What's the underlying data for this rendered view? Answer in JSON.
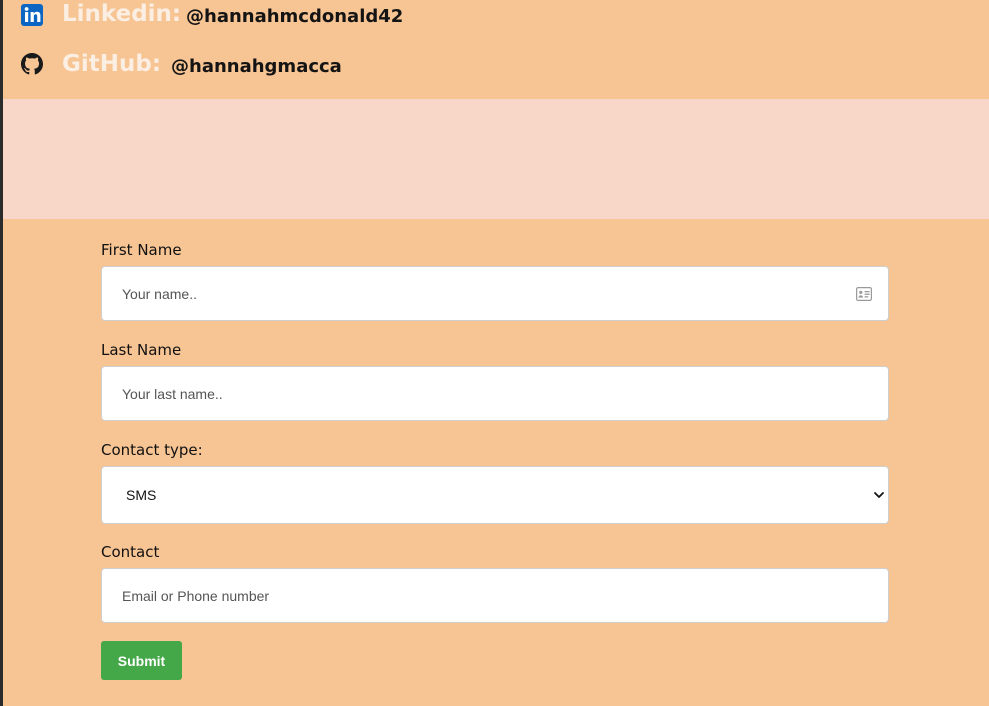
{
  "social": {
    "linkedin": {
      "label": "Linkedin:",
      "handle": "@hannahmcdonald42"
    },
    "github": {
      "label": "GitHub:",
      "handle": "@hannahgmacca"
    }
  },
  "form": {
    "first_name": {
      "label": "First Name",
      "placeholder": "Your name.."
    },
    "last_name": {
      "label": "Last Name",
      "placeholder": "Your last name.."
    },
    "contact_type": {
      "label": "Contact type:",
      "selected": "SMS"
    },
    "contact": {
      "label": "Contact",
      "placeholder": "Email or Phone number"
    },
    "submit_label": "Submit"
  },
  "colors": {
    "background": "#f7c493",
    "pink_band": "#f8d6c8",
    "social_label": "#fbeee2",
    "submit": "#44a748",
    "linkedin_blue": "#0a66c2"
  },
  "icons": [
    "linkedin-icon",
    "github-icon",
    "contact-card-icon",
    "chevron-down-icon"
  ]
}
